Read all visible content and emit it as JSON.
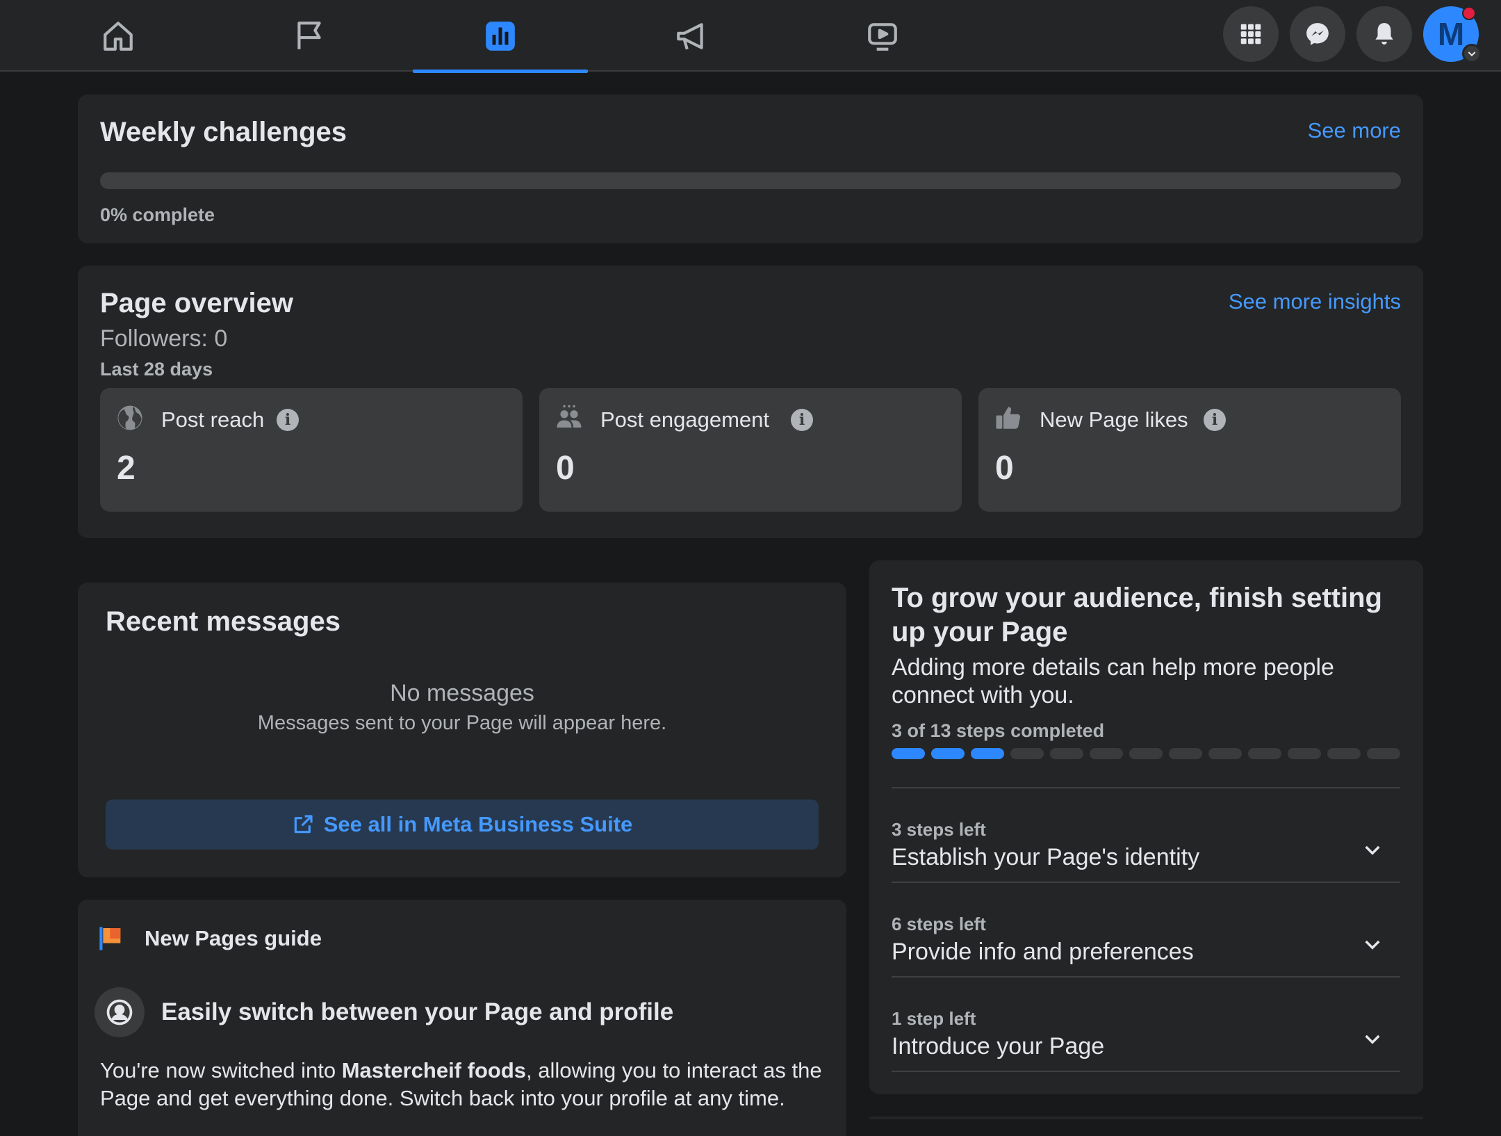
{
  "nav": {
    "tabs": [
      {
        "name": "home",
        "icon": "home-icon",
        "active": false
      },
      {
        "name": "pages",
        "icon": "flag-icon",
        "active": false
      },
      {
        "name": "insights",
        "icon": "bar-chart-icon",
        "active": true
      },
      {
        "name": "ads",
        "icon": "megaphone-icon",
        "active": false
      },
      {
        "name": "watch",
        "icon": "video-icon",
        "active": false
      }
    ],
    "right_buttons": [
      "menu-grid-icon",
      "messenger-icon",
      "bell-icon"
    ],
    "avatar_letter": "M",
    "accent_color": "#2d88ff"
  },
  "weekly": {
    "title": "Weekly challenges",
    "see_more": "See more",
    "progress_fraction": 0,
    "progress_text": "0% complete"
  },
  "overview": {
    "title": "Page overview",
    "see_more": "See more insights",
    "followers": "Followers: 0",
    "period": "Last 28 days",
    "metrics": [
      {
        "label": "Post reach",
        "value": "2",
        "icon": "globe-icon"
      },
      {
        "label": "Post engagement",
        "value": "0",
        "icon": "people-icon"
      },
      {
        "label": "New Page likes",
        "value": "0",
        "icon": "thumbs-up-icon"
      }
    ]
  },
  "messages": {
    "title": "Recent messages",
    "empty_title": "No messages",
    "empty_subtitle": "Messages sent to your Page will appear here.",
    "button": "See all in Meta Business Suite"
  },
  "guide": {
    "title": "New Pages guide",
    "item_title": "Easily switch between your Page and profile",
    "body_pre": "You're now switched into ",
    "body_bold": "Mastercheif foods",
    "body_post": ", allowing you to interact as the Page and get everything done. Switch back into your profile at any time."
  },
  "setup": {
    "title": "To grow your audience, finish setting up your Page",
    "subtitle": "Adding more details can help more people connect with you.",
    "progress_text": "3 of 13 steps completed",
    "steps_done": 3,
    "steps_total": 13,
    "sections": [
      {
        "count": "3 steps left",
        "name": "Establish your Page's identity"
      },
      {
        "count": "6 steps left",
        "name": "Provide info and preferences"
      },
      {
        "count": "1 step left",
        "name": "Introduce your Page"
      }
    ]
  }
}
